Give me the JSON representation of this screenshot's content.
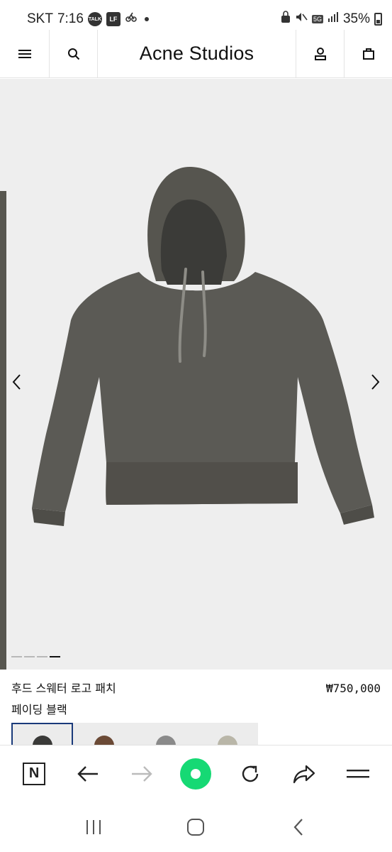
{
  "status_bar": {
    "carrier": "SKT",
    "time": "7:16",
    "talk_badge": "TALK",
    "app_badge": "LF",
    "network": "5G",
    "battery": "35%"
  },
  "header": {
    "logo": "Acne Studios",
    "icons": [
      "menu-icon",
      "search-icon",
      "account-icon",
      "bag-icon"
    ]
  },
  "gallery": {
    "slide_count": 4,
    "active_slide": 4,
    "background": "#eeeeee",
    "product_color": "#5b5a55"
  },
  "product": {
    "name": "후드 스웨터 로고 패치",
    "color": "페이딩 블랙",
    "price": "₩750,000"
  },
  "thumbnails": [
    {
      "color": "#3a3a38",
      "selected": true
    },
    {
      "color": "#6b4a36",
      "selected": false
    },
    {
      "color": "#8a8a8a",
      "selected": false
    },
    {
      "color": "#b9b6a8",
      "selected": false
    }
  ],
  "browser_toolbar": {
    "items": [
      "naver-home-icon",
      "back-arrow-icon",
      "forward-arrow-icon",
      "green-dot-icon",
      "refresh-icon",
      "share-icon",
      "menu-lines-icon"
    ],
    "accent": "#16d974"
  },
  "nav_bar": {
    "items": [
      "recent-apps-icon",
      "home-icon",
      "back-icon"
    ]
  }
}
